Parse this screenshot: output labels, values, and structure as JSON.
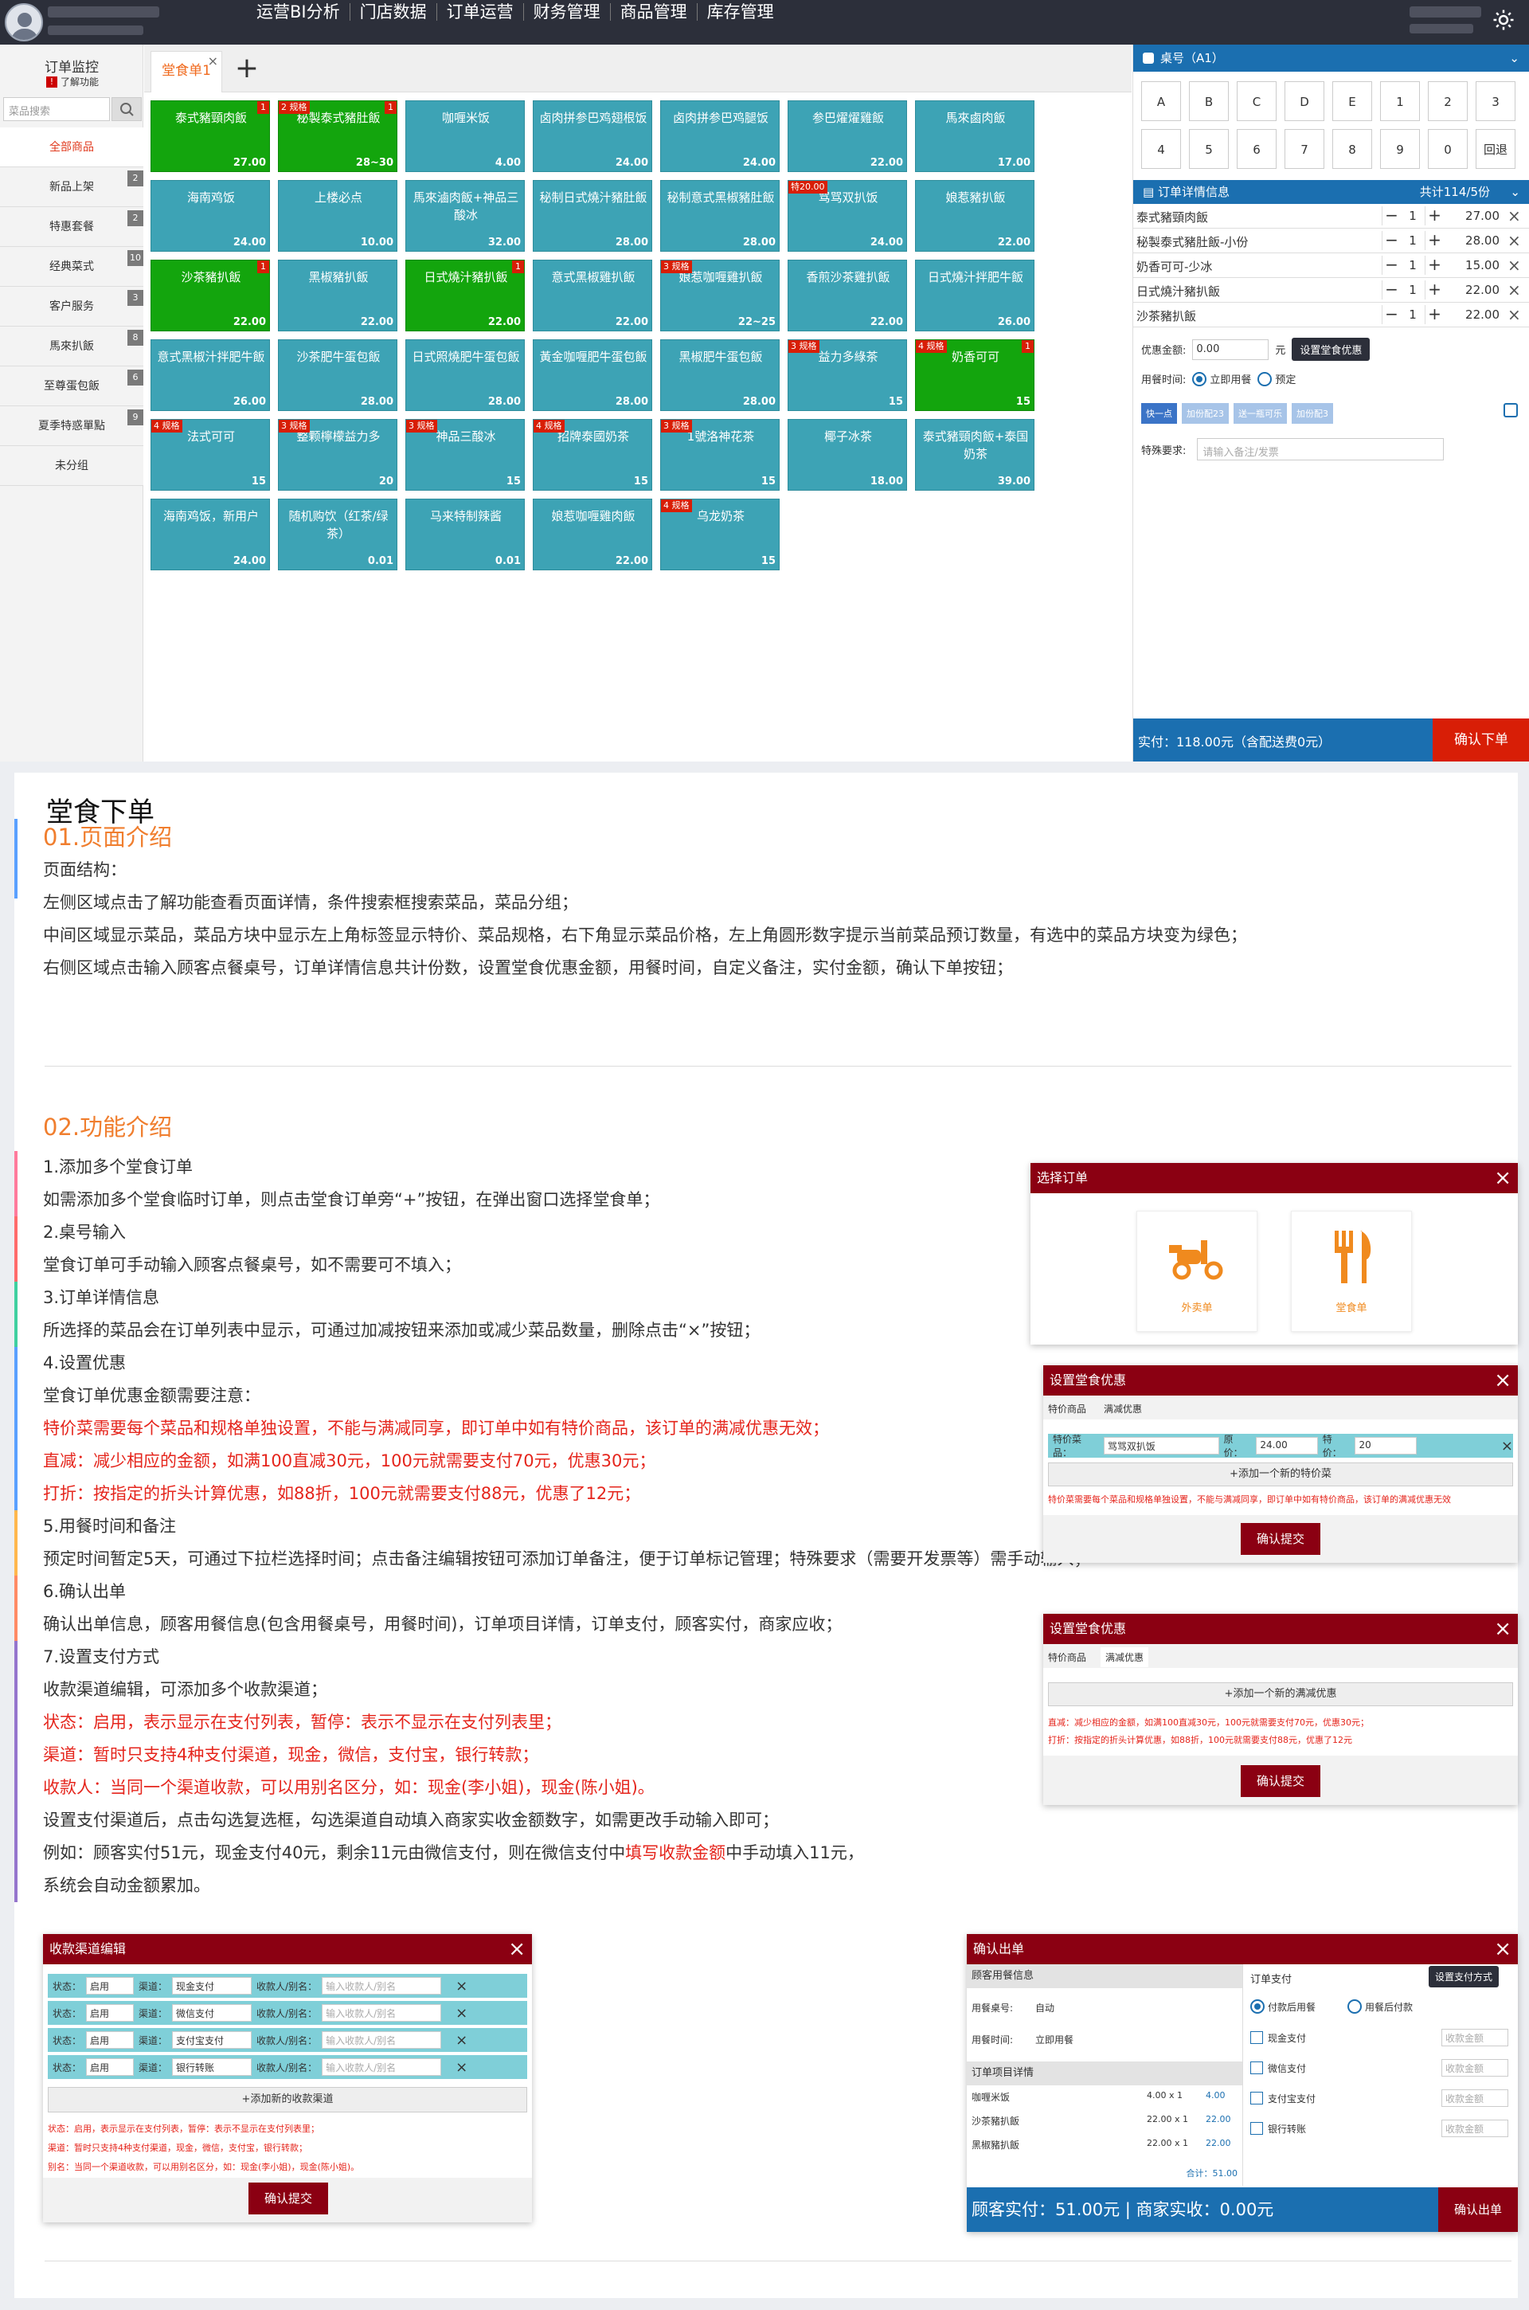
{
  "topbar": {
    "nav": [
      "运营BI分析",
      "门店数据",
      "订单运营",
      "财务管理",
      "商品管理",
      "库存管理"
    ]
  },
  "left": {
    "title": "订单监控",
    "help": "了解功能",
    "help_badge": "!",
    "search_placeholder": "菜品搜索",
    "categories": [
      {
        "label": "全部商品",
        "count": ""
      },
      {
        "label": "新品上架",
        "count": "2"
      },
      {
        "label": "特惠套餐",
        "count": "2"
      },
      {
        "label": "经典菜式",
        "count": "10"
      },
      {
        "label": "客户服务",
        "count": "3"
      },
      {
        "label": "馬來扒飯",
        "count": "8"
      },
      {
        "label": "至尊蛋包飯",
        "count": "6"
      },
      {
        "label": "夏季特惑單點",
        "count": "9"
      },
      {
        "label": "未分组",
        "count": ""
      }
    ]
  },
  "mid": {
    "tab": "堂食单1",
    "tab_close": "×",
    "tab_add": "+",
    "tiles": [
      {
        "name": "泰式豬頸肉飯",
        "price": "27.00",
        "sel": true,
        "tag": "",
        "count": "1"
      },
      {
        "name": "秘製泰式豬肚飯",
        "price": "28~30",
        "sel": true,
        "tag": "2 规格",
        "count": "1"
      },
      {
        "name": "咖喱米饭",
        "price": "4.00",
        "sel": false,
        "tag": "",
        "count": ""
      },
      {
        "name": "卤肉拼参巴鸡翅根饭",
        "price": "24.00",
        "sel": false,
        "tag": "",
        "count": ""
      },
      {
        "name": "卤肉拼参巴鸡腿饭",
        "price": "24.00",
        "sel": false,
        "tag": "",
        "count": ""
      },
      {
        "name": "参巴燿燿雞飯",
        "price": "22.00",
        "sel": false,
        "tag": "",
        "count": ""
      },
      {
        "name": "馬來鹵肉飯",
        "price": "17.00",
        "sel": false,
        "tag": "",
        "count": ""
      },
      {
        "name": "海南鸡饭",
        "price": "24.00",
        "sel": false,
        "tag": "",
        "count": ""
      },
      {
        "name": "上楼必点",
        "price": "10.00",
        "sel": false,
        "tag": "",
        "count": ""
      },
      {
        "name": "馬來滷肉飯+神品三酸冰",
        "price": "32.00",
        "sel": false,
        "tag": "",
        "count": ""
      },
      {
        "name": "秘制日式燒汁豬肚飯",
        "price": "28.00",
        "sel": false,
        "tag": "",
        "count": ""
      },
      {
        "name": "秘制意式黑椒豬肚飯",
        "price": "28.00",
        "sel": false,
        "tag": "",
        "count": ""
      },
      {
        "name": "骂骂双扒饭",
        "price": "24.00",
        "sel": false,
        "tag": "特20.00",
        "count": ""
      },
      {
        "name": "娘惹豬扒飯",
        "price": "22.00",
        "sel": false,
        "tag": "",
        "count": ""
      },
      {
        "name": "沙茶豬扒飯",
        "price": "22.00",
        "sel": true,
        "tag": "",
        "count": "1"
      },
      {
        "name": "黑椒豬扒飯",
        "price": "22.00",
        "sel": false,
        "tag": "",
        "count": ""
      },
      {
        "name": "日式燒汁豬扒飯",
        "price": "22.00",
        "sel": true,
        "tag": "",
        "count": "1"
      },
      {
        "name": "意式黑椒雞扒飯",
        "price": "22.00",
        "sel": false,
        "tag": "",
        "count": ""
      },
      {
        "name": "娘惹咖喱雞扒飯",
        "price": "22~25",
        "sel": false,
        "tag": "3 规格",
        "count": ""
      },
      {
        "name": "香煎沙茶雞扒飯",
        "price": "22.00",
        "sel": false,
        "tag": "",
        "count": ""
      },
      {
        "name": "日式燒汁拌肥牛飯",
        "price": "26.00",
        "sel": false,
        "tag": "",
        "count": ""
      },
      {
        "name": "意式黑椒汁拌肥牛飯",
        "price": "26.00",
        "sel": false,
        "tag": "",
        "count": ""
      },
      {
        "name": "沙茶肥牛蛋包飯",
        "price": "28.00",
        "sel": false,
        "tag": "",
        "count": ""
      },
      {
        "name": "日式照燒肥牛蛋包飯",
        "price": "28.00",
        "sel": false,
        "tag": "",
        "count": ""
      },
      {
        "name": "黃金咖喱肥牛蛋包飯",
        "price": "28.00",
        "sel": false,
        "tag": "",
        "count": ""
      },
      {
        "name": "黑椒肥牛蛋包飯",
        "price": "28.00",
        "sel": false,
        "tag": "",
        "count": ""
      },
      {
        "name": "益力多綠茶",
        "price": "15",
        "sel": false,
        "tag": "3 规格",
        "count": ""
      },
      {
        "name": "奶香可可",
        "price": "15",
        "sel": true,
        "tag": "4 规格",
        "count": "1"
      },
      {
        "name": "法式可可",
        "price": "15",
        "sel": false,
        "tag": "4 规格",
        "count": ""
      },
      {
        "name": "整颗檸檬益力多",
        "price": "20",
        "sel": false,
        "tag": "3 规格",
        "count": ""
      },
      {
        "name": "神品三酸冰",
        "price": "15",
        "sel": false,
        "tag": "3 规格",
        "count": ""
      },
      {
        "name": "招牌泰國奶茶",
        "price": "15",
        "sel": false,
        "tag": "4 规格",
        "count": ""
      },
      {
        "name": "1號洛神花茶",
        "price": "15",
        "sel": false,
        "tag": "3 规格",
        "count": ""
      },
      {
        "name": "椰子冰茶",
        "price": "18.00",
        "sel": false,
        "tag": "",
        "count": ""
      },
      {
        "name": "泰式豬頸肉飯+泰国奶茶",
        "price": "39.00",
        "sel": false,
        "tag": "",
        "count": ""
      },
      {
        "name": "海南鸡饭，新用户",
        "price": "24.00",
        "sel": false,
        "tag": "",
        "count": ""
      },
      {
        "name": "随机购饮（红茶/绿茶）",
        "price": "0.01",
        "sel": false,
        "tag": "",
        "count": ""
      },
      {
        "name": "马来特制辣酱",
        "price": "0.01",
        "sel": false,
        "tag": "",
        "count": ""
      },
      {
        "name": "娘惹咖喱雞肉飯",
        "price": "22.00",
        "sel": false,
        "tag": "",
        "count": ""
      },
      {
        "name": "乌龙奶茶",
        "price": "15",
        "sel": false,
        "tag": "4 规格",
        "count": ""
      }
    ]
  },
  "right": {
    "table_title": "桌号（A1）",
    "keys": [
      "A",
      "B",
      "C",
      "D",
      "E",
      "1",
      "2",
      "3",
      "4",
      "5",
      "6",
      "7",
      "8",
      "9",
      "0",
      "回退"
    ],
    "order_title": "订单详情信息",
    "order_total": "共计114/5份",
    "lines": [
      {
        "name": "泰式豬頸肉飯",
        "qty": "1",
        "price": "27.00"
      },
      {
        "name": "秘製泰式豬肚飯-小份",
        "qty": "1",
        "price": "28.00"
      },
      {
        "name": "奶香可可-少冰",
        "qty": "1",
        "price": "15.00"
      },
      {
        "name": "日式燒汁豬扒飯",
        "qty": "1",
        "price": "22.00"
      },
      {
        "name": "沙茶豬扒飯",
        "qty": "1",
        "price": "22.00"
      }
    ],
    "discount_label": "优惠金额:",
    "discount_value": "0.00",
    "discount_unit": "元",
    "discount_btn": "设置堂食优惠",
    "time_label": "用餐时间:",
    "time_now": "立即用餐",
    "time_book": "预定",
    "notes": [
      "快一点",
      "加份配23",
      "送一瓶可乐",
      "加份配3"
    ],
    "req_label": "特殊要求:",
    "req_placeholder": "请输入备注/发票",
    "pay_text": "实付：118.00元（含配送费0元）",
    "confirm": "确认下单",
    "accent": "#1b6fb0",
    "danger": "#d81e06"
  },
  "doc": {
    "title": "堂食下单",
    "s1_title": "01.页面介绍",
    "s1": [
      "页面结构：",
      "左侧区域点击了解功能查看页面详情，条件搜索框搜索菜品，菜品分组；",
      "中间区域显示菜品，菜品方块中显示左上角标签显示特价、菜品规格，右下角显示菜品价格，左上角圆形数字提示当前菜品预订数量，有选中的菜品方块变为绿色；",
      "右侧区域点击输入顾客点餐桌号，订单详情信息共计份数，设置堂食优惠金额，用餐时间，自定义备注，实付金额，确认下单按钮；"
    ],
    "s2_title": "02.功能介绍",
    "s2": [
      {
        "t": "1.添加多个堂食订单",
        "red": false
      },
      {
        "t": "如需添加多个堂食临时订单，则点击堂食订单旁“+”按钮，在弹出窗口选择堂食单；",
        "red": false
      },
      {
        "t": "2.桌号输入",
        "red": false
      },
      {
        "t": "堂食订单可手动输入顾客点餐桌号，如不需要可不填入；",
        "red": false
      },
      {
        "t": "3.订单详情信息",
        "red": false
      },
      {
        "t": "所选择的菜品会在订单列表中显示，可通过加减按钮来添加或减少菜品数量，删除点击“×”按钮；",
        "red": false
      },
      {
        "t": "4.设置优惠",
        "red": false
      },
      {
        "t": "堂食订单优惠金额需要注意：",
        "red": false
      },
      {
        "t": "特价菜需要每个菜品和规格单独设置，不能与满减同享，即订单中如有特价商品，该订单的满减优惠无效；",
        "red": true
      },
      {
        "t": "直减：减少相应的金额，如满100直减30元，100元就需要支付70元，优惠30元；",
        "red": true
      },
      {
        "t": "打折：按指定的折头计算优惠，如88折，100元就需要支付88元，优惠了12元；",
        "red": true
      },
      {
        "t": "5.用餐时间和备注",
        "red": false
      },
      {
        "t": "预定时间暂定5天，可通过下拉栏选择时间；点击备注编辑按钮可添加订单备注，便于订单标记管理；特殊要求（需要开发票等）需手动输入；",
        "red": false
      },
      {
        "t": "6.确认出单",
        "red": false
      },
      {
        "t": "确认出单信息，顾客用餐信息(包含用餐桌号，用餐时间)，订单项目详情，订单支付，顾客实付，商家应收；",
        "red": false
      },
      {
        "t": "7.设置支付方式",
        "red": false
      },
      {
        "t": "收款渠道编辑，可添加多个收款渠道；",
        "red": false
      },
      {
        "t": "状态：启用，表示显示在支付列表，暂停：表示不显示在支付列表里；",
        "red": true
      },
      {
        "t": "渠道：暂时只支持4种支付渠道，现金，微信，支付宝，银行转款；",
        "red": true
      },
      {
        "t": "收款人：当同一个渠道收款，可以用别名区分，如：现金(李小姐)，现金(陈小姐)。",
        "red": true
      },
      {
        "t": "设置支付渠道后，点击勾选复选框，勾选渠道自动填入商家实收金额数字，如需更改手动输入即可；",
        "red": false
      },
      {
        "t": "例如：顾客实付51元，现金支付40元，剩余11元由微信支付，则在微信支付中填写收款金额中手动填入11元，",
        "red": false
      },
      {
        "t": "系统会自动金额累加。",
        "red": false
      }
    ],
    "s2_hl": "填写收款金额",
    "bar_colors": [
      "#ff7a9c",
      "#ff6b6b",
      "#3fd0a0",
      "#5aa0ff",
      "#ffb74d",
      "#ff8a65",
      "#9575cd",
      "#64b5f6",
      "#4fc3f7",
      "#81c784",
      "#ffd54f"
    ]
  },
  "dlg_select": {
    "title": "选择订单",
    "opt1": "外卖单",
    "opt2": "堂食单",
    "close": "×"
  },
  "dlg_disc1": {
    "title": "设置堂食优惠",
    "tabs": [
      "特价商品",
      "满减优惠"
    ],
    "row_label": "特价菜品：",
    "row_item": "骂骂双扒饭",
    "orig_label": "原价：",
    "orig": "24.00",
    "special_label": "特价：",
    "special": "20",
    "add": "+添加一个新的特价菜",
    "note": "特价菜需要每个菜品和规格单独设置，不能与满减同享，即订单中如有特价商品，该订单的满减优惠无效",
    "submit": "确认提交",
    "close": "×"
  },
  "dlg_disc2": {
    "title": "设置堂食优惠",
    "tabs": [
      "特价商品",
      "满减优惠"
    ],
    "add": "+添加一个新的满减优惠",
    "note1": "直减：减少相应的金额，如满100直减30元，100元就需要支付70元，优惠30元；",
    "note2": "打折：按指定的折头计算优惠，如88折，100元就需要支付88元，优惠了12元",
    "submit": "确认提交",
    "close": "×"
  },
  "dlg_pay": {
    "title": "收款渠道编辑",
    "close": "×",
    "state_label": "状态：",
    "state_val": "启用",
    "ch_label": "渠道：",
    "payee_label": "收款人/别名：",
    "payee_ph": "输入收款人/别名",
    "channels": [
      "现金支付",
      "微信支付",
      "支付宝支付",
      "银行转账"
    ],
    "add": "+添加新的收款渠道",
    "notes": [
      "状态：启用，表示显示在支付列表，暂停：表示不显示在支付列表里；",
      "渠道：暂时只支持4种支付渠道，现金，微信，支付宝，银行转款；",
      "别名：当同一个渠道收款，可以用别名区分，如：现金(李小姐)，现金(陈小姐)。"
    ],
    "submit": "确认提交"
  },
  "dlg_confirm": {
    "title": "确认出单",
    "close": "×",
    "cust_title": "顾客用餐信息",
    "table_label": "用餐桌号:",
    "table_val": "自动",
    "time_label": "用餐时间:",
    "time_val": "立即用餐",
    "items_title": "订单项目详情",
    "items": [
      {
        "name": "咖喱米饭",
        "qty": "4.00 x 1",
        "amt": "4.00"
      },
      {
        "name": "沙茶豬扒飯",
        "qty": "22.00 x 1",
        "amt": "22.00"
      },
      {
        "name": "黑椒豬扒飯",
        "qty": "22.00 x 1",
        "amt": "22.00"
      }
    ],
    "subtotal": "合计：51.00",
    "pay_title": "订单支付",
    "pay_btn": "设置支付方式",
    "pay_mode1": "付款后用餐",
    "pay_mode2": "用餐后付款",
    "methods": [
      "现金支付",
      "微信支付",
      "支付宝支付",
      "银行转账"
    ],
    "amount_ph": "收款金额",
    "footer": "顾客实付：51.00元 | 商家实收：0.00元",
    "submit": "确认出单"
  }
}
